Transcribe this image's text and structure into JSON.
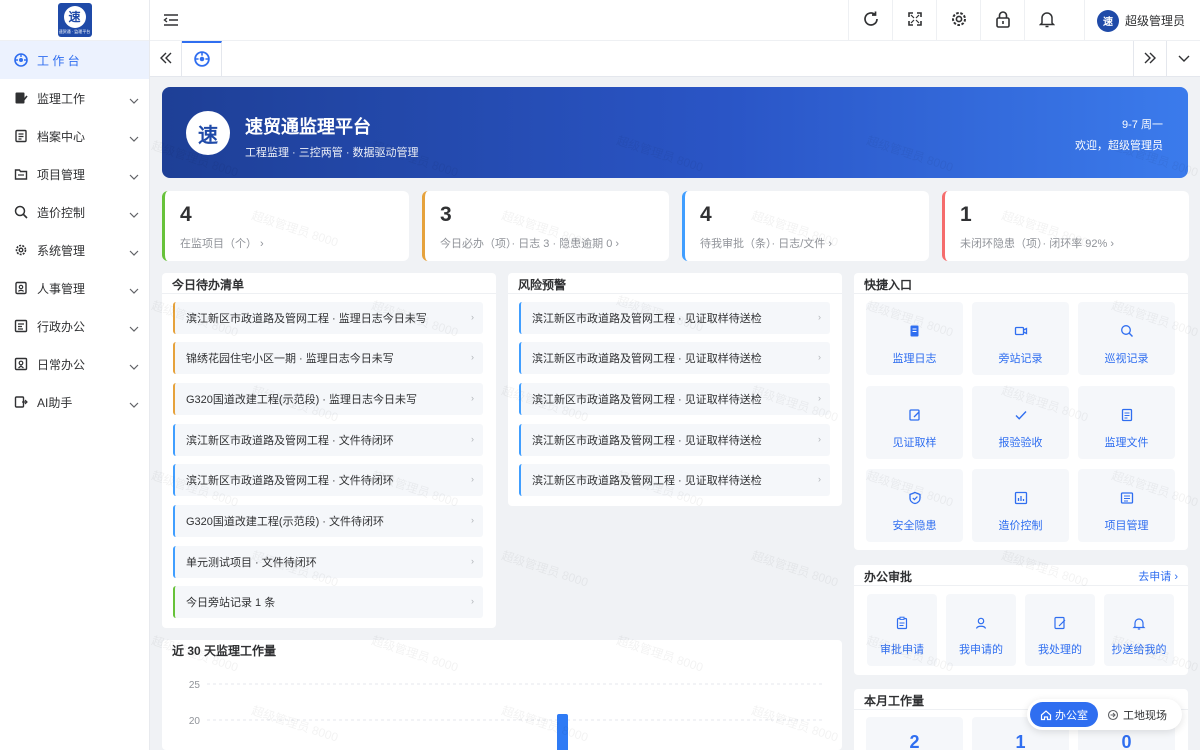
{
  "sidebar": {
    "logo_text": "速",
    "logo_sub": "速贸通 · 监理平台",
    "items": [
      {
        "label": "工 作 台"
      },
      {
        "label": "监理工作"
      },
      {
        "label": "档案中心"
      },
      {
        "label": "项目管理"
      },
      {
        "label": "造价控制"
      },
      {
        "label": "系统管理"
      },
      {
        "label": "人事管理"
      },
      {
        "label": "行政办公"
      },
      {
        "label": "日常办公"
      },
      {
        "label": "AI助手"
      }
    ]
  },
  "header": {
    "user_avatar": "速",
    "user_name": "超级管理员"
  },
  "banner": {
    "logo": "速",
    "title": "速贸通监理平台",
    "subtitle": "工程监理 · 三控两管 · 数据驱动管理",
    "date": "9-7 周一",
    "welcome": "欢迎，超级管理员"
  },
  "stats": [
    {
      "value": "4",
      "label": "在监项目（个） ›",
      "color": "#67c23a"
    },
    {
      "value": "3",
      "label": "今日必办（项）· 日志 3 · 隐患逾期 0 ›",
      "color": "#e6a23c"
    },
    {
      "value": "4",
      "label": "待我审批（条）· 日志/文件 ›",
      "color": "#409eff"
    },
    {
      "value": "1",
      "label": "未闭环隐患（项）· 闭环率 92% ›",
      "color": "#f56c6c"
    }
  ],
  "todo": {
    "title": "今日待办清单",
    "items": [
      {
        "text": "滨江新区市政道路及管网工程 · 监理日志今日未写",
        "color": "#e6a23c"
      },
      {
        "text": "锦绣花园住宅小区一期 · 监理日志今日未写",
        "color": "#e6a23c"
      },
      {
        "text": "G320国道改建工程(示范段) · 监理日志今日未写",
        "color": "#e6a23c"
      },
      {
        "text": "滨江新区市政道路及管网工程 · 文件待闭环",
        "color": "#409eff"
      },
      {
        "text": "滨江新区市政道路及管网工程 · 文件待闭环",
        "color": "#409eff"
      },
      {
        "text": "G320国道改建工程(示范段) · 文件待闭环",
        "color": "#409eff"
      },
      {
        "text": "单元测试项目 · 文件待闭环",
        "color": "#409eff"
      },
      {
        "text": "今日旁站记录 1 条",
        "color": "#67c23a"
      }
    ]
  },
  "risk": {
    "title": "风险预警",
    "items": [
      {
        "text": "滨江新区市政道路及管网工程 · 见证取样待送检"
      },
      {
        "text": "滨江新区市政道路及管网工程 · 见证取样待送检"
      },
      {
        "text": "滨江新区市政道路及管网工程 · 见证取样待送检"
      },
      {
        "text": "滨江新区市政道路及管网工程 · 见证取样待送检"
      },
      {
        "text": "滨江新区市政道路及管网工程 · 见证取样待送检"
      }
    ]
  },
  "quick": {
    "title": "快捷入口",
    "items": [
      {
        "label": "监理日志",
        "icon": "journal-icon"
      },
      {
        "label": "旁站记录",
        "icon": "video-icon"
      },
      {
        "label": "巡视记录",
        "icon": "search-icon"
      },
      {
        "label": "见证取样",
        "icon": "edit-icon"
      },
      {
        "label": "报验验收",
        "icon": "check-icon"
      },
      {
        "label": "监理文件",
        "icon": "document-icon"
      },
      {
        "label": "安全隐患",
        "icon": "shield-icon"
      },
      {
        "label": "造价控制",
        "icon": "chart-icon"
      },
      {
        "label": "项目管理",
        "icon": "list-icon"
      }
    ]
  },
  "approval": {
    "title": "办公审批",
    "link": "去申请 ›",
    "items": [
      {
        "label": "审批申请",
        "icon": "clipboard-icon"
      },
      {
        "label": "我申请的",
        "icon": "user-icon"
      },
      {
        "label": "我处理的",
        "icon": "edit-doc-icon"
      },
      {
        "label": "抄送给我的",
        "icon": "bell-icon"
      }
    ]
  },
  "monthly": {
    "title": "本月工作量",
    "values": [
      "2",
      "1",
      "0"
    ]
  },
  "chart_data": {
    "type": "bar",
    "title": "近 30 天监理工作量",
    "y_ticks": [
      "25",
      "20"
    ],
    "ylim": [
      0,
      25
    ],
    "grid": true
  },
  "float": {
    "office": "办公室",
    "site": "工地现场"
  },
  "watermark": "超级管理员 8000"
}
